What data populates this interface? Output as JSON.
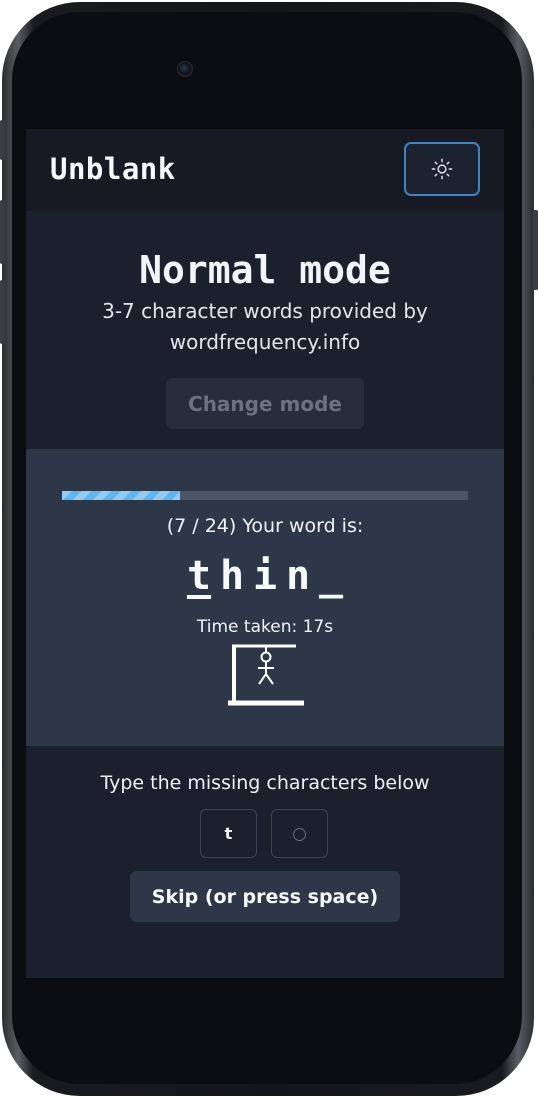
{
  "app": {
    "title": "Unblank"
  },
  "theme_toggle": {
    "icon": "sun-icon"
  },
  "mode": {
    "title": "Normal mode",
    "description_line1": "3-7 character words provided by",
    "description_line2": "wordfrequency.info",
    "change_label": "Change mode"
  },
  "game": {
    "progress_fraction": 0.2917,
    "word_count_label": "(7 / 24) Your word is:",
    "letters": [
      {
        "char": "t",
        "guessed": true
      },
      {
        "char": "h",
        "guessed": false
      },
      {
        "char": "i",
        "guessed": false
      },
      {
        "char": "n",
        "guessed": false
      },
      {
        "char": "_",
        "guessed": false
      }
    ],
    "time_label": "Time taken: 17s",
    "hangman_icon": "hangman-gallows-icon"
  },
  "input": {
    "prompt": "Type the missing characters below",
    "boxes": [
      {
        "value": "t"
      },
      {
        "value": "○"
      }
    ],
    "skip_label": "Skip (or press space)"
  },
  "colors": {
    "accent": "#3f83c3",
    "progress": "#90cdf4",
    "background": "#1a202c"
  }
}
